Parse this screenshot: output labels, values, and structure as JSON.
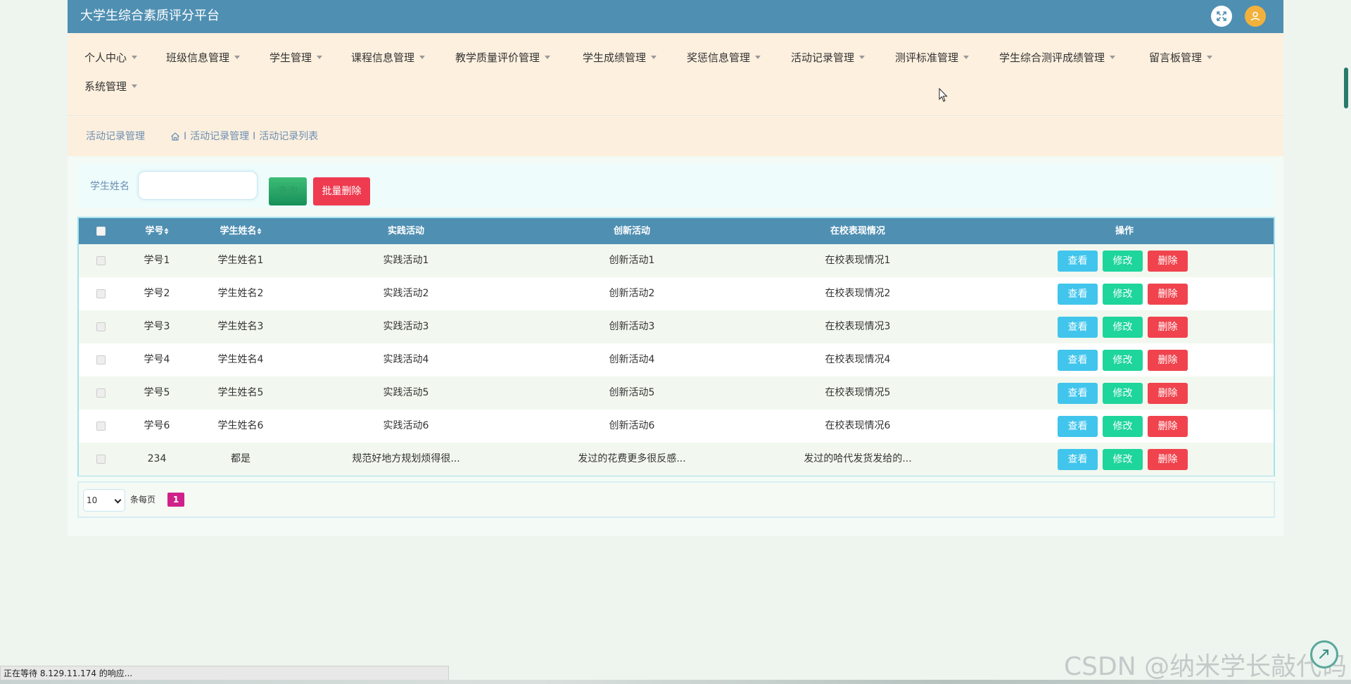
{
  "app": {
    "title": "大学生综合素质评分平台"
  },
  "nav": {
    "items": [
      {
        "label": "个人中心"
      },
      {
        "label": "班级信息管理"
      },
      {
        "label": "学生管理"
      },
      {
        "label": "课程信息管理"
      },
      {
        "label": "教学质量评价管理"
      },
      {
        "label": "学生成绩管理"
      },
      {
        "label": "奖惩信息管理"
      },
      {
        "label": "活动记录管理"
      },
      {
        "label": "测评标准管理"
      },
      {
        "label": "学生综合测评成绩管理"
      },
      {
        "label": "留言板管理"
      },
      {
        "label": "系统管理"
      }
    ]
  },
  "breadcrumb": {
    "title": "活动记录管理",
    "separator": "I",
    "path": [
      "活动记录管理",
      "活动记录列表"
    ]
  },
  "search": {
    "label": "学生姓名",
    "value": "",
    "search_button": "查询",
    "batch_delete_button": "批量删除"
  },
  "table": {
    "headers": {
      "id": "学号",
      "name": "学生姓名",
      "practice": "实践活动",
      "innovation": "创新活动",
      "performance": "在校表现情况",
      "actions": "操作"
    },
    "rows": [
      {
        "id": "学号1",
        "name": "学生姓名1",
        "practice": "实践活动1",
        "innovation": "创新活动1",
        "performance": "在校表现情况1"
      },
      {
        "id": "学号2",
        "name": "学生姓名2",
        "practice": "实践活动2",
        "innovation": "创新活动2",
        "performance": "在校表现情况2"
      },
      {
        "id": "学号3",
        "name": "学生姓名3",
        "practice": "实践活动3",
        "innovation": "创新活动3",
        "performance": "在校表现情况3"
      },
      {
        "id": "学号4",
        "name": "学生姓名4",
        "practice": "实践活动4",
        "innovation": "创新活动4",
        "performance": "在校表现情况4"
      },
      {
        "id": "学号5",
        "name": "学生姓名5",
        "practice": "实践活动5",
        "innovation": "创新活动5",
        "performance": "在校表现情况5"
      },
      {
        "id": "学号6",
        "name": "学生姓名6",
        "practice": "实践活动6",
        "innovation": "创新活动6",
        "performance": "在校表现情况6"
      },
      {
        "id": "234",
        "name": "都是",
        "practice": "规范好地方规划烦得很...",
        "innovation": "发过的花费更多很反感...",
        "performance": "发过的哈代发货发给的..."
      }
    ],
    "actions": {
      "view": "查看",
      "edit": "修改",
      "delete": "删除"
    }
  },
  "pagination": {
    "page_size": "10",
    "per_page_label": "条每页",
    "current_page": "1"
  },
  "status_bar": {
    "text": "正在等待 8.129.11.174 的响应..."
  },
  "watermark": {
    "text": "CSDN @纳米学长敲代码"
  },
  "colors": {
    "header": "#4f8fb2",
    "nav_bg": "#fdf0df",
    "view_button": "#41c5ec",
    "edit_button": "#1ed59b",
    "delete_button": "#f0434d",
    "batch_delete": "#ee3b50",
    "current_page": "#d0218a"
  },
  "icons": {
    "expand": "fullscreen-icon",
    "avatar": "user-icon",
    "home": "home-icon",
    "help": "help-icon"
  }
}
